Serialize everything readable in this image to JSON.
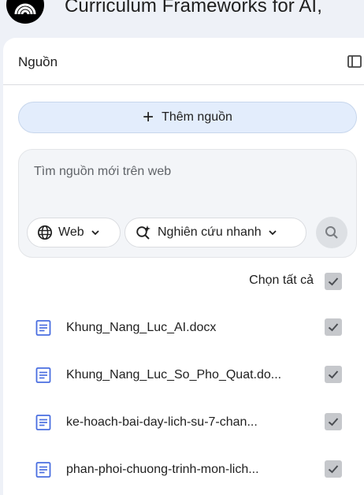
{
  "app": {
    "title": "Curriculum Frameworks for AI,"
  },
  "sources_panel": {
    "title": "Nguồn",
    "add_button": "Thêm nguồn",
    "search": {
      "placeholder": "Tìm nguồn mới trên web",
      "source_type": "Web",
      "mode": "Nghiên cứu nhanh"
    },
    "select_all_label": "Chọn tất cả",
    "select_all_checked": true,
    "items": [
      {
        "name": "Khung_Nang_Luc_AI.docx",
        "checked": true
      },
      {
        "name": "Khung_Nang_Luc_So_Pho_Quat.do...",
        "checked": true
      },
      {
        "name": "ke-hoach-bai-day-lich-su-7-chan...",
        "checked": true
      },
      {
        "name": "phan-phoi-chuong-trinh-mon-lich...",
        "checked": true
      }
    ]
  },
  "colors": {
    "accent_blue": "#4a6ee0",
    "add_button_bg": "#e3edfc",
    "checkbox_bg": "#c6c8cc"
  },
  "icons": [
    "notebook-logo-icon",
    "panel-toggle-icon",
    "plus-icon",
    "globe-icon",
    "chevron-down-icon",
    "search-sparkle-icon",
    "search-icon",
    "check-icon",
    "document-icon"
  ]
}
